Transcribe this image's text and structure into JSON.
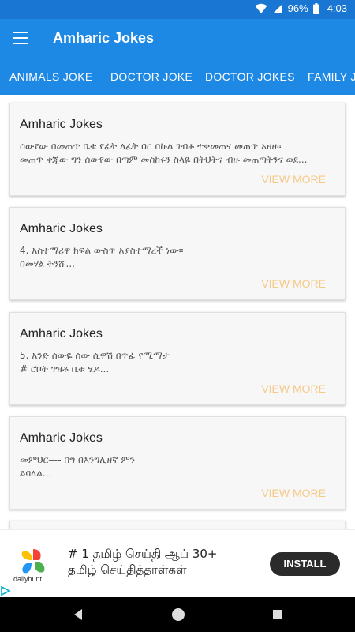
{
  "status_bar": {
    "battery": "96%",
    "time": "4:03",
    "icons": [
      "wifi-icon",
      "signal-icon",
      "battery-icon"
    ]
  },
  "app_bar": {
    "title": "Amharic Jokes",
    "menu_icon": "hamburger-menu-icon"
  },
  "tabs": [
    {
      "label": "ANIMALS JOKE"
    },
    {
      "label": "DOCTOR JOKE"
    },
    {
      "label": "DOCTOR JOKES"
    },
    {
      "label": "FAMILY J"
    }
  ],
  "cards": [
    {
      "title": "Amharic Jokes",
      "body": "ሰውየው በመጠጥ ቤቱ የፊት ለፊት በር በኩል ገብቶ ተቀመጠና መጠጥ አዘዘ።\nመጠጥ ቀጂው ግን ሰውየው በጣም መስከሩን ስላዬ በትህትና ብዙ መጠጣትንና ወደ...",
      "action": "VIEW MORE"
    },
    {
      "title": "Amharic Jokes",
      "body": "4. አስተማሪዋ ክፍል ውስጥ እያስተማረች ነው።\nበመሃል ትንሹ...",
      "action": "VIEW MORE"
    },
    {
      "title": "Amharic Jokes",
      "body": "5. አንድ ሰውዬ ሰው ሲዋሽ በጥፊ የሚማታ\n# ሮቦት ገዝቶ ቤቱ ሄዶ...",
      "action": "VIEW MORE"
    },
    {
      "title": "Amharic Jokes",
      "body": "መምህር—- በግ በእንግሊዘኛ ምን\nይባላል...",
      "action": "VIEW MORE"
    }
  ],
  "ad": {
    "brand": "dailyhunt",
    "text": "# 1 தமிழ் செய்தி ஆப் 30+\nதமிழ் செய்தித்தாள்கள்",
    "button": "INSTALL",
    "colors": {
      "button_bg": "#2b2b2b"
    }
  },
  "colors": {
    "primary": "#1e88e5",
    "status_bar": "#1976d2",
    "view_more": "#f6c987"
  },
  "nav": {
    "icons": [
      "back-icon",
      "home-icon",
      "recent-apps-icon"
    ]
  }
}
